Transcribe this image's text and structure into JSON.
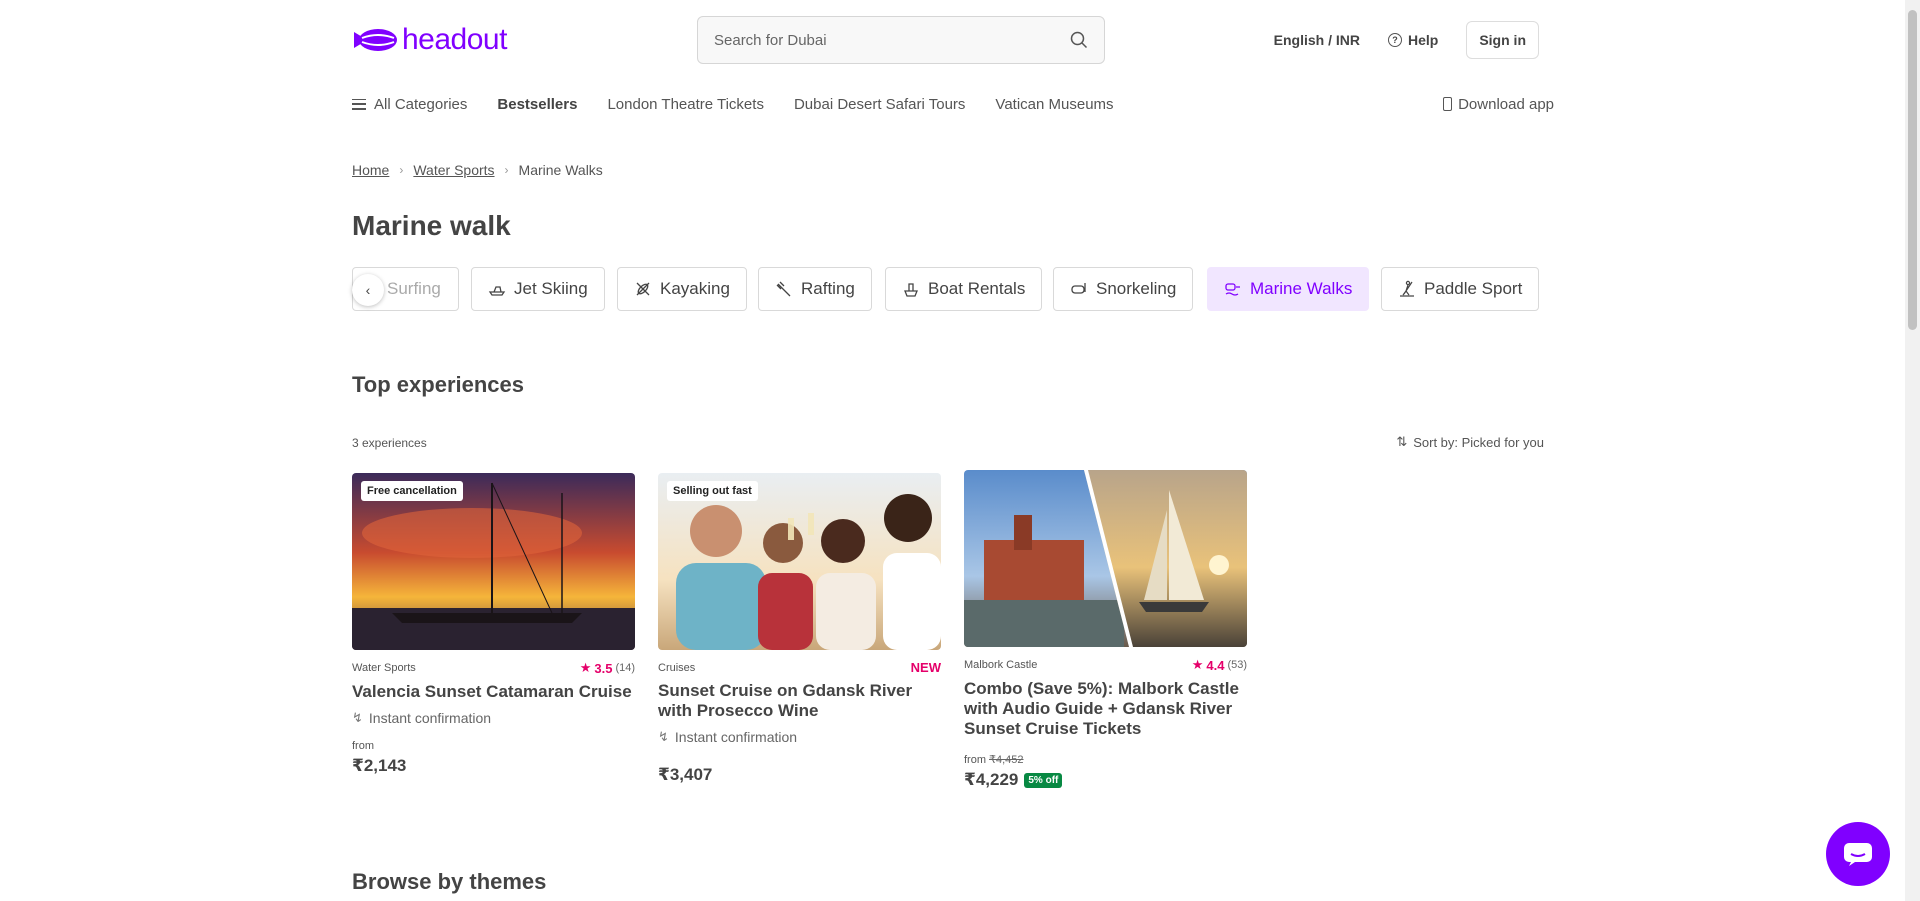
{
  "header": {
    "logo_text": "headout",
    "search_placeholder": "Search for Dubai",
    "language": "English / INR",
    "help": "Help",
    "sign_in": "Sign in"
  },
  "nav": {
    "all_categories": "All Categories",
    "items": [
      "Bestsellers",
      "London Theatre Tickets",
      "Dubai Desert Safari Tours",
      "Vatican Museums"
    ],
    "download_app": "Download app"
  },
  "breadcrumb": {
    "home": "Home",
    "category": "Water Sports",
    "current": "Marine Walks"
  },
  "page_title": "Marine walk",
  "chips": [
    {
      "label": "Surfing",
      "icon": "surf-icon",
      "active": false
    },
    {
      "label": "Jet Skiing",
      "icon": "jetski-icon",
      "active": false
    },
    {
      "label": "Kayaking",
      "icon": "kayak-icon",
      "active": false
    },
    {
      "label": "Rafting",
      "icon": "raft-icon",
      "active": false
    },
    {
      "label": "Boat Rentals",
      "icon": "boat-icon",
      "active": false
    },
    {
      "label": "Snorkeling",
      "icon": "snorkel-icon",
      "active": false
    },
    {
      "label": "Marine Walks",
      "icon": "marine-walk-icon",
      "active": true
    },
    {
      "label": "Paddle Sport",
      "icon": "paddle-icon",
      "active": false
    }
  ],
  "top_experiences": {
    "title": "Top experiences",
    "count": "3 experiences",
    "sort_label": "Sort by: Picked for you"
  },
  "cards": [
    {
      "badge": "Free cancellation",
      "category": "Water Sports",
      "rating": "3.5",
      "reviews": "(14)",
      "title": "Valencia Sunset Catamaran Cruise",
      "instant": "Instant confirmation",
      "from": "from",
      "price": "₹2,143"
    },
    {
      "badge": "Selling out fast",
      "category": "Cruises",
      "tag": "NEW",
      "title": "Sunset Cruise on Gdansk River with Prosecco Wine",
      "instant": "Instant confirmation",
      "price": "₹3,407"
    },
    {
      "category": "Malbork Castle",
      "rating": "4.4",
      "reviews": "(53)",
      "title": "Combo (Save 5%): Malbork Castle with Audio Guide + Gdansk River Sunset Cruise Tickets",
      "from": "from",
      "original_price": "₹4,452",
      "price": "₹4,229",
      "discount": "5% off"
    }
  ],
  "browse_title": "Browse by themes",
  "colors": {
    "brand": "#8000ff",
    "rating": "#e5006a",
    "discount": "#088943",
    "active_chip_bg": "#f1e6ff"
  }
}
